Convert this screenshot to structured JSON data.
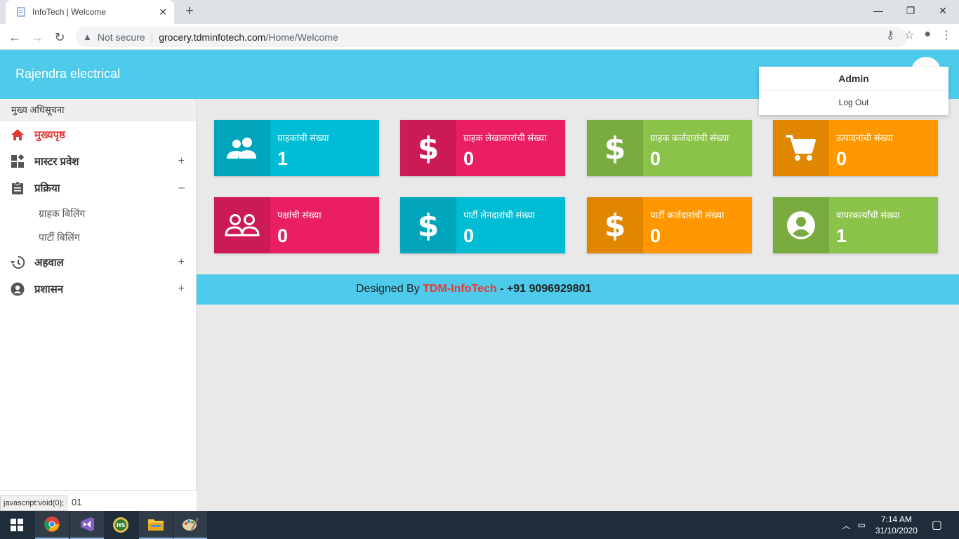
{
  "browser": {
    "tab_title": "InfoTech | Welcome",
    "security_label": "Not secure",
    "url_domain": "grocery.tdminfotech.com",
    "url_path": "/Home/Welcome"
  },
  "app": {
    "brand": "Rajendra electrical"
  },
  "user_menu": {
    "name": "Admin",
    "logout_label": "Log Out"
  },
  "sidebar": {
    "heading": "मुख्य अधिसूचना",
    "items": [
      {
        "label": "मुख्यपृष्ठ",
        "icon": "home-icon",
        "toggle": ""
      },
      {
        "label": "मास्टर प्रवेश",
        "icon": "dashboard-icon",
        "toggle": "+"
      },
      {
        "label": "प्रक्रिया",
        "icon": "clipboard-icon",
        "toggle": "–"
      },
      {
        "label": "अहवाल",
        "icon": "history-icon",
        "toggle": "+"
      },
      {
        "label": "प्रशासन",
        "icon": "account-icon",
        "toggle": "+"
      }
    ],
    "sub_items": [
      "ग्राहक बिलिंग",
      "पार्टी बिलिंग"
    ],
    "footer_text": "01",
    "status_tip": "javascript:void(0);"
  },
  "cards": [
    {
      "label": "ग्राहकांची संख्या",
      "value": "1",
      "icon": "group-icon",
      "color": "#00bcd4",
      "icon_bg": "#00a5bb"
    },
    {
      "label": "ग्राहक लेखाकारांची संख्या",
      "value": "0",
      "icon": "dollar-icon",
      "color": "#e91e63",
      "icon_bg": "#cc1a57"
    },
    {
      "label": "ग्राहक कर्जदारांची संख्या",
      "value": "0",
      "icon": "dollar-icon",
      "color": "#8bc34a",
      "icon_bg": "#7aab40"
    },
    {
      "label": "उत्पादनांची संख्या",
      "value": "0",
      "icon": "cart-icon",
      "color": "#ff9800",
      "icon_bg": "#e08600"
    },
    {
      "label": "पक्षांची संख्या",
      "value": "0",
      "icon": "people-outline-icon",
      "color": "#e91e63",
      "icon_bg": "#cc1a57"
    },
    {
      "label": "पार्टी लेनदारांची संख्या",
      "value": "0",
      "icon": "dollar-icon",
      "color": "#00bcd4",
      "icon_bg": "#00a5bb"
    },
    {
      "label": "पार्टी कर्जदारांची संख्या",
      "value": "0",
      "icon": "dollar-icon",
      "color": "#ff9800",
      "icon_bg": "#e08600"
    },
    {
      "label": "वापरकर्त्यांची संख्या",
      "value": "1",
      "icon": "account-circle-icon",
      "color": "#8bc34a",
      "icon_bg": "#7aab40"
    }
  ],
  "footer": {
    "prefix": "Designed By",
    "brand": "TDM-InfoTech",
    "phone": "- +91 9096929801"
  },
  "taskbar": {
    "time": "7:14 AM",
    "date": "31/10/2020"
  }
}
